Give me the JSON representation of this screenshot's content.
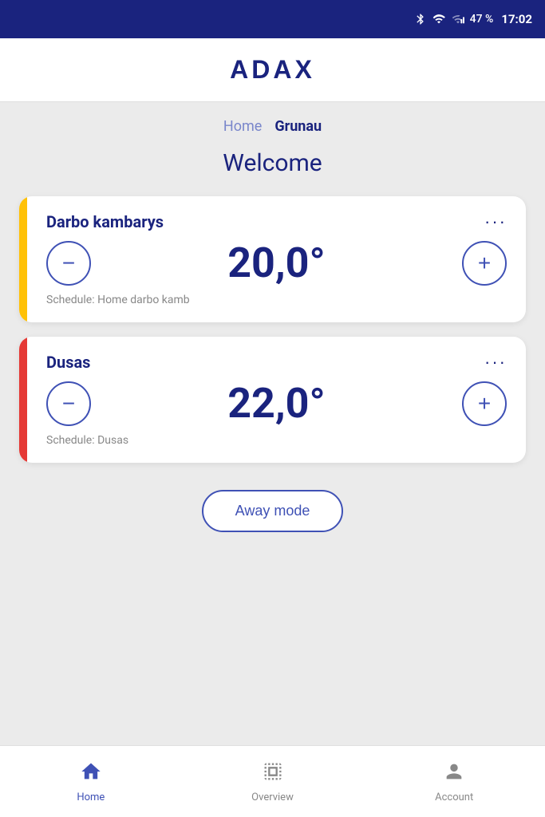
{
  "statusBar": {
    "battery": "47 %",
    "time": "17:02"
  },
  "header": {
    "logo": "ADAX"
  },
  "breadcrumb": {
    "home": "Home",
    "current": "Grunau"
  },
  "welcome": "Welcome",
  "rooms": [
    {
      "id": "darbo-kambarys",
      "name": "Darbo kambarys",
      "temperature": "20,0°",
      "schedule": "Schedule: Home darbo kamb",
      "indicator": "yellow"
    },
    {
      "id": "dusas",
      "name": "Dusas",
      "temperature": "22,0°",
      "schedule": "Schedule: Dusas",
      "indicator": "orange"
    }
  ],
  "awayModeBtn": "Away mode",
  "nav": {
    "items": [
      {
        "id": "home",
        "label": "Home",
        "active": true
      },
      {
        "id": "overview",
        "label": "Overview",
        "active": false
      },
      {
        "id": "account",
        "label": "Account",
        "active": false
      }
    ]
  }
}
